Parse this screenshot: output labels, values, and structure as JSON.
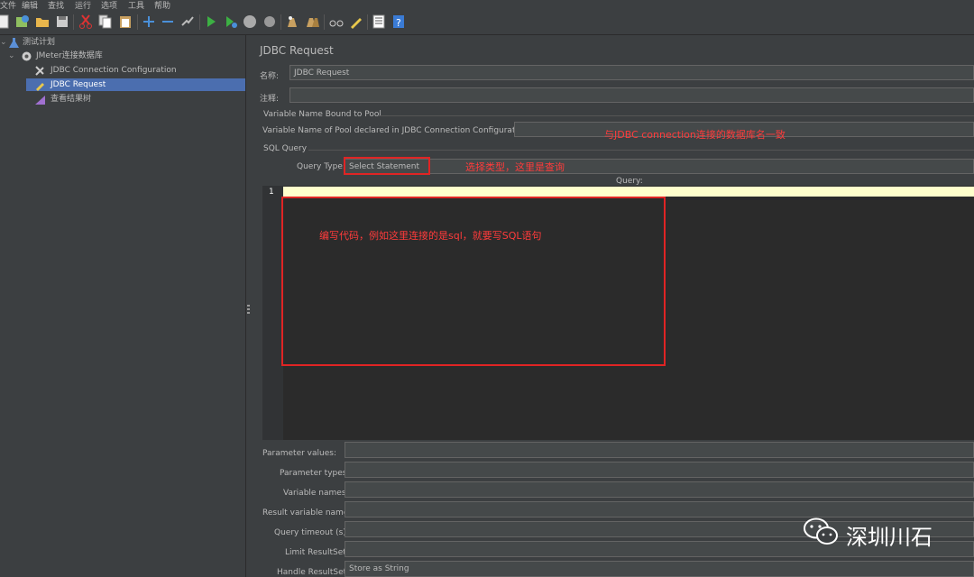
{
  "menu": [
    "文件",
    "编辑",
    "查找",
    "运行",
    "选项",
    "工具",
    "帮助"
  ],
  "tree": {
    "root": "测试计划",
    "group": "JMeter连接数据库",
    "items": [
      "JDBC Connection Configuration",
      "JDBC Request",
      "查看结果树"
    ],
    "selected": "JDBC Request"
  },
  "form": {
    "title": "JDBC Request",
    "name_label": "名称:",
    "name_value": "JDBC Request",
    "comment_label": "注释:",
    "comment_value": "",
    "pool_group": "Variable Name Bound to Pool",
    "pool_label": "Variable Name of Pool declared in JDBC Connection Configuration:",
    "pool_value": "",
    "sql_group": "SQL Query",
    "query_type_label": "Query Type:",
    "query_type_value": "Select Statement",
    "query_label": "Query:",
    "line_number": "1",
    "params": [
      {
        "label": "Parameter values:",
        "value": ""
      },
      {
        "label": "Parameter types:",
        "value": ""
      },
      {
        "label": "Variable names:",
        "value": ""
      },
      {
        "label": "Result variable name:",
        "value": ""
      },
      {
        "label": "Query timeout (s):",
        "value": ""
      },
      {
        "label": "Limit ResultSet:",
        "value": ""
      },
      {
        "label": "Handle ResultSet:",
        "value": "Store as String"
      }
    ]
  },
  "annotations": {
    "pool": "与JDBC connection连接的数据库名一致",
    "query_type": "选择类型，这里是查询",
    "query": "编写代码，例如这里连接的是sql，就要写SQL语句"
  },
  "watermark": "深圳川石",
  "colors": {
    "selection": "#4b6eaf",
    "annotation": "#ff3b3b",
    "current_line": "#ffffcc"
  }
}
